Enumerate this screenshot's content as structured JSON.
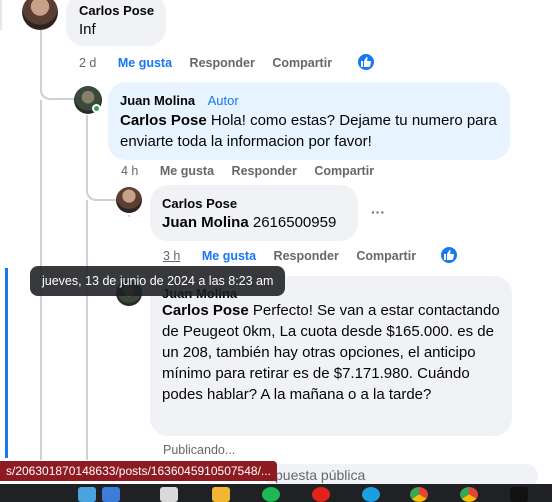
{
  "comments": {
    "c1": {
      "author": "Carlos Pose",
      "text": "Inf",
      "time": "2 d",
      "like": "Me gusta",
      "reply": "Responder",
      "share": "Compartir"
    },
    "c2": {
      "author": "Juan Molina",
      "badge": "Autor",
      "mention": "Carlos Pose",
      "text": "Hola! como estas? Dejame tu numero para enviarte toda la informacion por favor!",
      "time": "4 h",
      "like": "Me gusta",
      "reply": "Responder",
      "share": "Compartir"
    },
    "c3": {
      "author": "Carlos Pose",
      "mention": "Juan Molina",
      "text": "2616500959",
      "time": "3 h",
      "like": "Me gusta",
      "reply": "Responder",
      "share": "Compartir",
      "more": "···"
    },
    "c4": {
      "author": "Juan Molina",
      "mention": "Carlos Pose",
      "text": "Perfecto! Se van a estar contactando de Peugeot 0km, La cuota desde $165.000. es de un 208, también hay otras opciones, el anticipo mínimo para retirar es de $7.171.980. Cuándo podes hablar? A la mañana o a la tarde?",
      "status": "Publicando..."
    }
  },
  "tooltip": "jueves, 13 de junio de 2024 a las 8:23 am",
  "reply_box": {
    "placeholder": "spuesta pública"
  },
  "status_url": "s/206301870148633/posts/1636045910507548/...",
  "colors": {
    "accent": "#1877f2",
    "bubble": "#f0f2f5",
    "bubble_active": "#e7f3ff",
    "status_bar": "#8f1b22"
  }
}
